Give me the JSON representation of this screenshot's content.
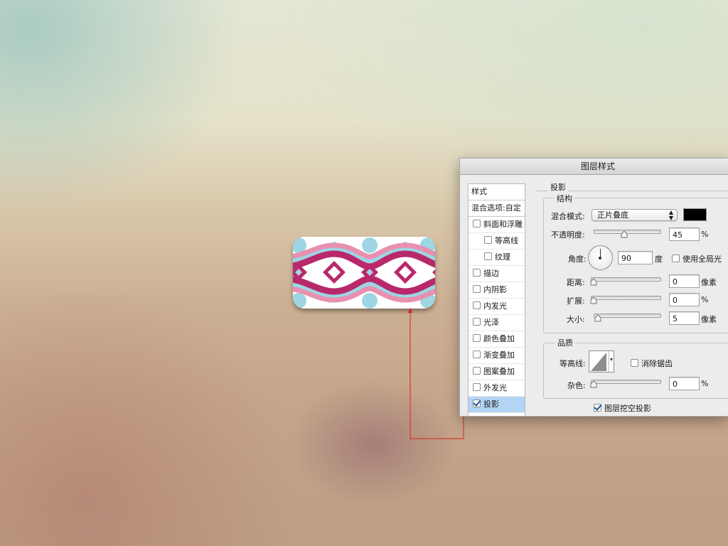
{
  "dialog": {
    "title": "图层样式",
    "styles_list": {
      "header": "样式",
      "blend_options": "混合选项:自定",
      "items": [
        {
          "label": "斜面和浮雕",
          "checked": false,
          "sub": false,
          "selected": false
        },
        {
          "label": "等高线",
          "checked": false,
          "sub": true,
          "selected": false
        },
        {
          "label": "纹理",
          "checked": false,
          "sub": true,
          "selected": false
        },
        {
          "label": "描边",
          "checked": false,
          "sub": false,
          "selected": false
        },
        {
          "label": "内阴影",
          "checked": false,
          "sub": false,
          "selected": false
        },
        {
          "label": "内发光",
          "checked": false,
          "sub": false,
          "selected": false
        },
        {
          "label": "光泽",
          "checked": false,
          "sub": false,
          "selected": false
        },
        {
          "label": "颜色叠加",
          "checked": false,
          "sub": false,
          "selected": false
        },
        {
          "label": "渐变叠加",
          "checked": false,
          "sub": false,
          "selected": false
        },
        {
          "label": "图案叠加",
          "checked": false,
          "sub": false,
          "selected": false
        },
        {
          "label": "外发光",
          "checked": false,
          "sub": false,
          "selected": false
        },
        {
          "label": "投影",
          "checked": true,
          "sub": false,
          "selected": true
        }
      ]
    },
    "drop_shadow": {
      "section_title": "投影",
      "structure": {
        "title": "结构",
        "blend_mode_label": "混合模式:",
        "blend_mode_value": "正片叠底",
        "shadow_color": "#000000",
        "opacity_label": "不透明度:",
        "opacity_value": "45",
        "opacity_unit": "%",
        "opacity_fraction": 0.45,
        "angle_label": "角度:",
        "angle_value": "90",
        "angle_unit": "度",
        "global_light_label": "使用全局光",
        "global_light_checked": false,
        "distance_label": "距离:",
        "distance_value": "0",
        "distance_unit": "像素",
        "spread_label": "扩展:",
        "spread_value": "0",
        "spread_unit": "%",
        "size_label": "大小:",
        "size_value": "5",
        "size_unit": "像素"
      },
      "quality": {
        "title": "品质",
        "contour_label": "等高线:",
        "anti_alias_label": "消除锯齿",
        "anti_alias_checked": false,
        "noise_label": "杂色:",
        "noise_value": "0",
        "noise_unit": "%"
      },
      "knockout_label": "图层挖空投影",
      "knockout_checked": true
    }
  },
  "sample_pattern_colors": {
    "magenta": "#b8286a",
    "pink": "#e98fb0",
    "light_blue": "#9dd6e2",
    "white": "#ffffff"
  },
  "connector_color": "#d8231c"
}
